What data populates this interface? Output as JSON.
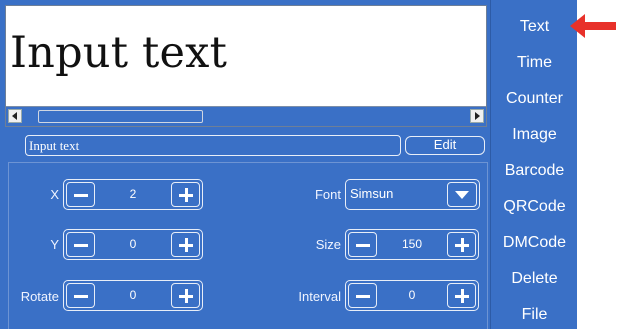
{
  "preview": {
    "text": "Input text"
  },
  "text_field": {
    "value": "Input text",
    "edit_label": "Edit"
  },
  "params": {
    "x": {
      "label": "X",
      "value": "2"
    },
    "y": {
      "label": "Y",
      "value": "0"
    },
    "rotate": {
      "label": "Rotate",
      "value": "0"
    },
    "font": {
      "label": "Font",
      "value": "Simsun"
    },
    "size": {
      "label": "Size",
      "value": "150"
    },
    "interval": {
      "label": "Interval",
      "value": "0"
    }
  },
  "menu": {
    "items": [
      {
        "label": "Text",
        "active": true
      },
      {
        "label": "Time"
      },
      {
        "label": "Counter"
      },
      {
        "label": "Image"
      },
      {
        "label": "Barcode"
      },
      {
        "label": "QRCode"
      },
      {
        "label": "DMCode"
      },
      {
        "label": "Delete"
      },
      {
        "label": "File"
      }
    ]
  },
  "colors": {
    "panel": "#3a70c6",
    "annotation_arrow": "#e8312a"
  }
}
